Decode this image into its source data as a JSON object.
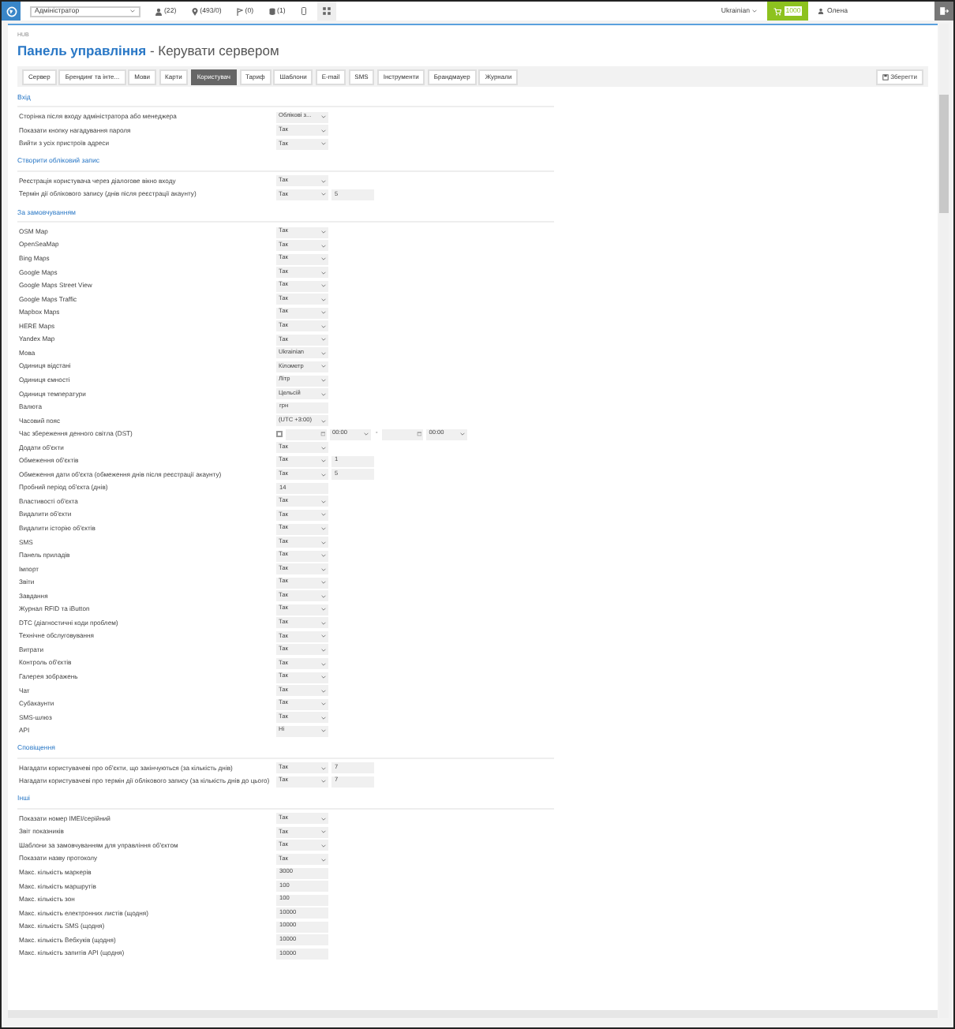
{
  "top_bar": {
    "role_select": "Адміністратор",
    "counters": [
      {
        "kind": "users",
        "text": "(22)"
      },
      {
        "kind": "objects",
        "text": "(493/0)"
      },
      {
        "kind": "markers",
        "text": "(0)"
      },
      {
        "kind": "database",
        "text": "(1)"
      }
    ],
    "language": "Ukrainian",
    "cart": "1000",
    "user": "Олена"
  },
  "header": {
    "breadcrumb": "HUB",
    "title": "Панель управління",
    "subtitle": " - Керувати сервером"
  },
  "tabs": [
    {
      "label": "Сервер",
      "selected": false
    },
    {
      "label": "Брендинг та інте...",
      "selected": false
    },
    {
      "label": "Мови",
      "selected": false
    },
    {
      "label": "Карти",
      "selected": false
    },
    {
      "label": "Користувач",
      "selected": true
    },
    {
      "label": "Тариф",
      "selected": false
    },
    {
      "label": "Шаблони",
      "selected": false
    },
    {
      "label": "E-mail",
      "selected": false
    },
    {
      "label": "SMS",
      "selected": false
    },
    {
      "label": "Інструменти",
      "selected": false
    },
    {
      "label": "Брандмауер",
      "selected": false
    },
    {
      "label": "Журнали",
      "selected": false
    }
  ],
  "save_button": "Зберегти",
  "sections": [
    {
      "title": "Вхід",
      "rows": [
        {
          "kind": "select",
          "label": "Сторінка після входу адміністратора або менеджера",
          "value": "Облікові з..."
        },
        {
          "kind": "select",
          "label": "Показати кнопку нагадування пароля",
          "value": "Так"
        },
        {
          "kind": "select",
          "label": "Вийти з усіх пристроїв адреси",
          "value": "Так"
        }
      ]
    },
    {
      "title": "Створити обліковий запис",
      "rows": [
        {
          "kind": "select",
          "label": "Реєстрація користувача через діалогове вікно входу",
          "value": "Так"
        },
        {
          "kind": "select_input",
          "label": "Термін дії облікового запису (днів після реєстрації акаунту)",
          "value": "Так",
          "extra": "5"
        }
      ]
    },
    {
      "title": "За замовчуванням",
      "rows": [
        {
          "kind": "select",
          "label": "OSM Map",
          "value": "Так"
        },
        {
          "kind": "select",
          "label": "OpenSeaMap",
          "value": "Так"
        },
        {
          "kind": "select",
          "label": "Bing Maps",
          "value": "Так"
        },
        {
          "kind": "select",
          "label": "Google Maps",
          "value": "Так"
        },
        {
          "kind": "select",
          "label": "Google Maps Street View",
          "value": "Так"
        },
        {
          "kind": "select",
          "label": "Google Maps Traffic",
          "value": "Так"
        },
        {
          "kind": "select",
          "label": "Mapbox Maps",
          "value": "Так"
        },
        {
          "kind": "select",
          "label": "HERE Maps",
          "value": "Так"
        },
        {
          "kind": "select",
          "label": "Yandex Map",
          "value": "Так"
        },
        {
          "kind": "select",
          "label": "Мова",
          "value": "Ukrainian"
        },
        {
          "kind": "select",
          "label": "Одиниця відстані",
          "value": "Кілометр"
        },
        {
          "kind": "select",
          "label": "Одиниця ємності",
          "value": "Літр"
        },
        {
          "kind": "select",
          "label": "Одиниця температури",
          "value": "Цельсій"
        },
        {
          "kind": "text",
          "label": "Валюта",
          "value": "грн"
        },
        {
          "kind": "select",
          "label": "Часовий пояс",
          "value": "(UTC +3:00)"
        },
        {
          "kind": "dst",
          "label": "Час збереження денного світла (DST)",
          "checked": false,
          "from_time": "00:00",
          "separator": "-",
          "to_time": "00:00"
        },
        {
          "kind": "select",
          "label": "Додати об'єкти",
          "value": "Так"
        },
        {
          "kind": "select_input",
          "label": "Обмеження об'єктів",
          "value": "Так",
          "extra": "1"
        },
        {
          "kind": "select_input",
          "label": "Обмеження дати об'єкта (обмеження днів після реєстрації акаунту)",
          "value": "Так",
          "extra": "5"
        },
        {
          "kind": "text",
          "label": "Пробний період об'єкта (днів)",
          "value": "14"
        },
        {
          "kind": "select",
          "label": "Властивості об'єкта",
          "value": "Так"
        },
        {
          "kind": "select",
          "label": "Видалити об'єкти",
          "value": "Так"
        },
        {
          "kind": "select",
          "label": "Видалити історію об'єктів",
          "value": "Так"
        },
        {
          "kind": "select",
          "label": "SMS",
          "value": "Так"
        },
        {
          "kind": "select",
          "label": "Панель приладів",
          "value": "Так"
        },
        {
          "kind": "select",
          "label": "Імпорт",
          "value": "Так"
        },
        {
          "kind": "select",
          "label": "Звіти",
          "value": "Так"
        },
        {
          "kind": "select",
          "label": "Завдання",
          "value": "Так"
        },
        {
          "kind": "select",
          "label": "Журнал RFID та iButton",
          "value": "Так"
        },
        {
          "kind": "select",
          "label": "DTC (діагностичні коди проблем)",
          "value": "Так"
        },
        {
          "kind": "select",
          "label": "Технічне обслуговування",
          "value": "Так"
        },
        {
          "kind": "select",
          "label": "Витрати",
          "value": "Так"
        },
        {
          "kind": "select",
          "label": "Контроль об'єктів",
          "value": "Так"
        },
        {
          "kind": "select",
          "label": "Галерея зображень",
          "value": "Так"
        },
        {
          "kind": "select",
          "label": "Чат",
          "value": "Так"
        },
        {
          "kind": "select",
          "label": "Субакаунти",
          "value": "Так"
        },
        {
          "kind": "select",
          "label": "SMS-шлюз",
          "value": "Так"
        },
        {
          "kind": "select",
          "label": "API",
          "value": "Ні"
        }
      ]
    },
    {
      "title": "Сповіщення",
      "rows": [
        {
          "kind": "select_input",
          "label": "Нагадати користувачеві про об'єкти, що закінчуються (за кількість днів)",
          "value": "Так",
          "extra": "7"
        },
        {
          "kind": "select_input",
          "label": "Нагадати користувачеві про термін дії облікового запису (за кількість днів до цього)",
          "value": "Так",
          "extra": "7"
        }
      ]
    },
    {
      "title": "Інші",
      "rows": [
        {
          "kind": "select",
          "label": "Показати номер IMEI/серійний",
          "value": "Так"
        },
        {
          "kind": "select",
          "label": "Звіт показників",
          "value": "Так"
        },
        {
          "kind": "select",
          "label": "Шаблони за замовчуванням для управління об'єктом",
          "value": "Так"
        },
        {
          "kind": "select",
          "label": "Показати назву протоколу",
          "value": "Так"
        },
        {
          "kind": "text",
          "label": "Макс. кількість маркерів",
          "value": "3000"
        },
        {
          "kind": "text",
          "label": "Макс. кількість маршрутів",
          "value": "100"
        },
        {
          "kind": "text",
          "label": "Макс. кількість зон",
          "value": "100"
        },
        {
          "kind": "text",
          "label": "Макс. кількість електронних листів (щодня)",
          "value": "10000"
        },
        {
          "kind": "text",
          "label": "Макс. кількість SMS (щодня)",
          "value": "10000"
        },
        {
          "kind": "text",
          "label": "Макс. кількість Вебхуків (щодня)",
          "value": "10000"
        },
        {
          "kind": "text",
          "label": "Макс. кількість запитів API (щодня)",
          "value": "10000"
        }
      ]
    }
  ]
}
